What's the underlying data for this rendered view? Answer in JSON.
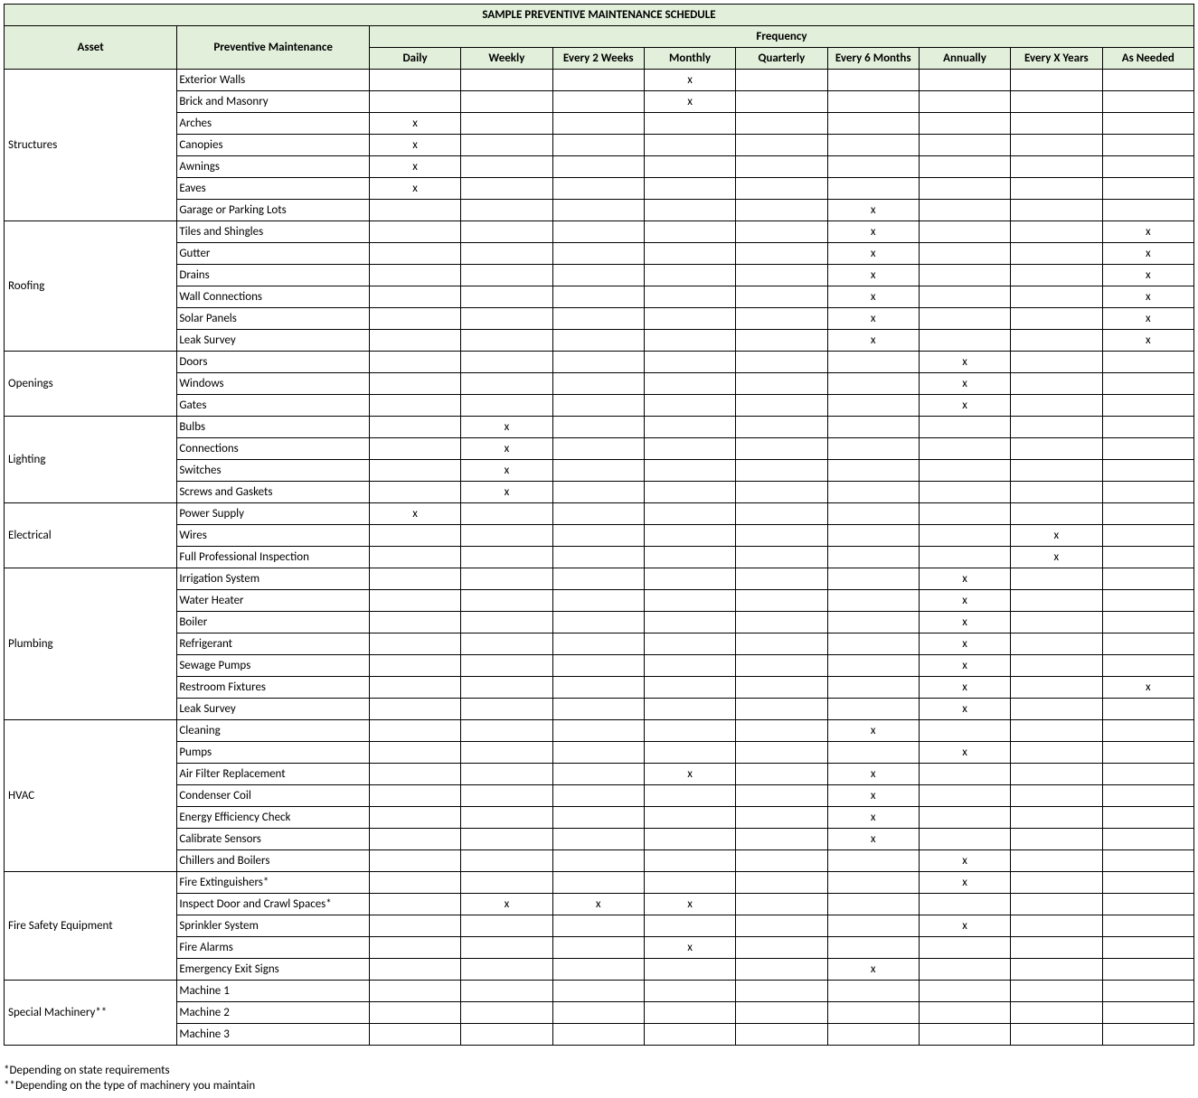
{
  "title": "SAMPLE PREVENTIVE MAINTENANCE SCHEDULE",
  "headers": {
    "asset": "Asset",
    "pm": "Preventive Maintenance",
    "freq": "Frequency",
    "cols": [
      "Daily",
      "Weekly",
      "Every 2 Weeks",
      "Monthly",
      "Quarterly",
      "Every 6 Months",
      "Annually",
      "Every X Years",
      "As Needed"
    ]
  },
  "mark": "x",
  "groups": [
    {
      "asset": "Structures",
      "rows": [
        {
          "pm": "Exterior Walls",
          "f": [
            "",
            "",
            "",
            "x",
            "",
            "",
            "",
            "",
            ""
          ]
        },
        {
          "pm": "Brick and Masonry",
          "f": [
            "",
            "",
            "",
            "x",
            "",
            "",
            "",
            "",
            ""
          ]
        },
        {
          "pm": "Arches",
          "f": [
            "x",
            "",
            "",
            "",
            "",
            "",
            "",
            "",
            ""
          ]
        },
        {
          "pm": "Canopies",
          "f": [
            "x",
            "",
            "",
            "",
            "",
            "",
            "",
            "",
            ""
          ]
        },
        {
          "pm": "Awnings",
          "f": [
            "x",
            "",
            "",
            "",
            "",
            "",
            "",
            "",
            ""
          ]
        },
        {
          "pm": "Eaves",
          "f": [
            "x",
            "",
            "",
            "",
            "",
            "",
            "",
            "",
            ""
          ]
        },
        {
          "pm": "Garage or Parking Lots",
          "f": [
            "",
            "",
            "",
            "",
            "",
            "x",
            "",
            "",
            ""
          ]
        }
      ]
    },
    {
      "asset": "Roofing",
      "rows": [
        {
          "pm": "Tiles and Shingles",
          "f": [
            "",
            "",
            "",
            "",
            "",
            "x",
            "",
            "",
            "x"
          ]
        },
        {
          "pm": "Gutter",
          "f": [
            "",
            "",
            "",
            "",
            "",
            "x",
            "",
            "",
            "x"
          ]
        },
        {
          "pm": "Drains",
          "f": [
            "",
            "",
            "",
            "",
            "",
            "x",
            "",
            "",
            "x"
          ]
        },
        {
          "pm": "Wall Connections",
          "f": [
            "",
            "",
            "",
            "",
            "",
            "x",
            "",
            "",
            "x"
          ]
        },
        {
          "pm": "Solar Panels",
          "f": [
            "",
            "",
            "",
            "",
            "",
            "x",
            "",
            "",
            "x"
          ]
        },
        {
          "pm": "Leak Survey",
          "f": [
            "",
            "",
            "",
            "",
            "",
            "x",
            "",
            "",
            "x"
          ]
        }
      ]
    },
    {
      "asset": "Openings",
      "rows": [
        {
          "pm": "Doors",
          "f": [
            "",
            "",
            "",
            "",
            "",
            "",
            "x",
            "",
            ""
          ]
        },
        {
          "pm": "Windows",
          "f": [
            "",
            "",
            "",
            "",
            "",
            "",
            "x",
            "",
            ""
          ]
        },
        {
          "pm": "Gates",
          "f": [
            "",
            "",
            "",
            "",
            "",
            "",
            "x",
            "",
            ""
          ]
        }
      ]
    },
    {
      "asset": "Lighting",
      "rows": [
        {
          "pm": "Bulbs",
          "f": [
            "",
            "x",
            "",
            "",
            "",
            "",
            "",
            "",
            ""
          ]
        },
        {
          "pm": "Connections",
          "f": [
            "",
            "x",
            "",
            "",
            "",
            "",
            "",
            "",
            ""
          ]
        },
        {
          "pm": "Switches",
          "f": [
            "",
            "x",
            "",
            "",
            "",
            "",
            "",
            "",
            ""
          ]
        },
        {
          "pm": "Screws and Gaskets",
          "f": [
            "",
            "x",
            "",
            "",
            "",
            "",
            "",
            "",
            ""
          ]
        }
      ]
    },
    {
      "asset": "Electrical",
      "rows": [
        {
          "pm": "Power Supply",
          "f": [
            "x",
            "",
            "",
            "",
            "",
            "",
            "",
            "",
            ""
          ]
        },
        {
          "pm": "Wires",
          "f": [
            "",
            "",
            "",
            "",
            "",
            "",
            "",
            "x",
            ""
          ]
        },
        {
          "pm": "Full Professional Inspection",
          "f": [
            "",
            "",
            "",
            "",
            "",
            "",
            "",
            "x",
            ""
          ]
        }
      ]
    },
    {
      "asset": "Plumbing",
      "rows": [
        {
          "pm": "Irrigation System",
          "f": [
            "",
            "",
            "",
            "",
            "",
            "",
            "x",
            "",
            ""
          ]
        },
        {
          "pm": "Water Heater",
          "f": [
            "",
            "",
            "",
            "",
            "",
            "",
            "x",
            "",
            ""
          ]
        },
        {
          "pm": "Boiler",
          "f": [
            "",
            "",
            "",
            "",
            "",
            "",
            "x",
            "",
            ""
          ]
        },
        {
          "pm": "Refrigerant",
          "f": [
            "",
            "",
            "",
            "",
            "",
            "",
            "x",
            "",
            ""
          ]
        },
        {
          "pm": "Sewage Pumps",
          "f": [
            "",
            "",
            "",
            "",
            "",
            "",
            "x",
            "",
            ""
          ]
        },
        {
          "pm": "Restroom Fixtures",
          "f": [
            "",
            "",
            "",
            "",
            "",
            "",
            "x",
            "",
            "x"
          ]
        },
        {
          "pm": "Leak Survey",
          "f": [
            "",
            "",
            "",
            "",
            "",
            "",
            "x",
            "",
            ""
          ]
        }
      ]
    },
    {
      "asset": "HVAC",
      "rows": [
        {
          "pm": "Cleaning",
          "f": [
            "",
            "",
            "",
            "",
            "",
            "x",
            "",
            "",
            ""
          ]
        },
        {
          "pm": "Pumps",
          "f": [
            "",
            "",
            "",
            "",
            "",
            "",
            "x",
            "",
            ""
          ]
        },
        {
          "pm": "Air Filter Replacement",
          "f": [
            "",
            "",
            "",
            "x",
            "",
            "x",
            "",
            "",
            ""
          ]
        },
        {
          "pm": "Condenser Coil",
          "f": [
            "",
            "",
            "",
            "",
            "",
            "x",
            "",
            "",
            ""
          ]
        },
        {
          "pm": "Energy Efficiency Check",
          "f": [
            "",
            "",
            "",
            "",
            "",
            "x",
            "",
            "",
            ""
          ]
        },
        {
          "pm": "Calibrate Sensors",
          "f": [
            "",
            "",
            "",
            "",
            "",
            "x",
            "",
            "",
            ""
          ]
        },
        {
          "pm": "Chillers and Boilers",
          "f": [
            "",
            "",
            "",
            "",
            "",
            "",
            "x",
            "",
            ""
          ]
        }
      ]
    },
    {
      "asset": "Fire Safety Equipment",
      "rows": [
        {
          "pm": "Fire Extinguishers*",
          "f": [
            "",
            "",
            "",
            "",
            "",
            "",
            "x",
            "",
            ""
          ]
        },
        {
          "pm": "Inspect Door and Crawl Spaces*",
          "f": [
            "",
            "x",
            "x",
            "x",
            "",
            "",
            "",
            "",
            ""
          ]
        },
        {
          "pm": "Sprinkler System",
          "f": [
            "",
            "",
            "",
            "",
            "",
            "",
            "x",
            "",
            ""
          ]
        },
        {
          "pm": "Fire Alarms",
          "f": [
            "",
            "",
            "",
            "x",
            "",
            "",
            "",
            "",
            ""
          ]
        },
        {
          "pm": "Emergency Exit Signs",
          "f": [
            "",
            "",
            "",
            "",
            "",
            "x",
            "",
            "",
            ""
          ]
        }
      ]
    },
    {
      "asset": "Special Machinery**",
      "rows": [
        {
          "pm": "Machine 1",
          "f": [
            "",
            "",
            "",
            "",
            "",
            "",
            "",
            "",
            ""
          ]
        },
        {
          "pm": "Machine 2",
          "f": [
            "",
            "",
            "",
            "",
            "",
            "",
            "",
            "",
            ""
          ]
        },
        {
          "pm": "Machine 3",
          "f": [
            "",
            "",
            "",
            "",
            "",
            "",
            "",
            "",
            ""
          ]
        }
      ]
    }
  ],
  "footnotes": [
    "*Depending on state requirements",
    "**Depending on the type of machinery you maintain"
  ]
}
